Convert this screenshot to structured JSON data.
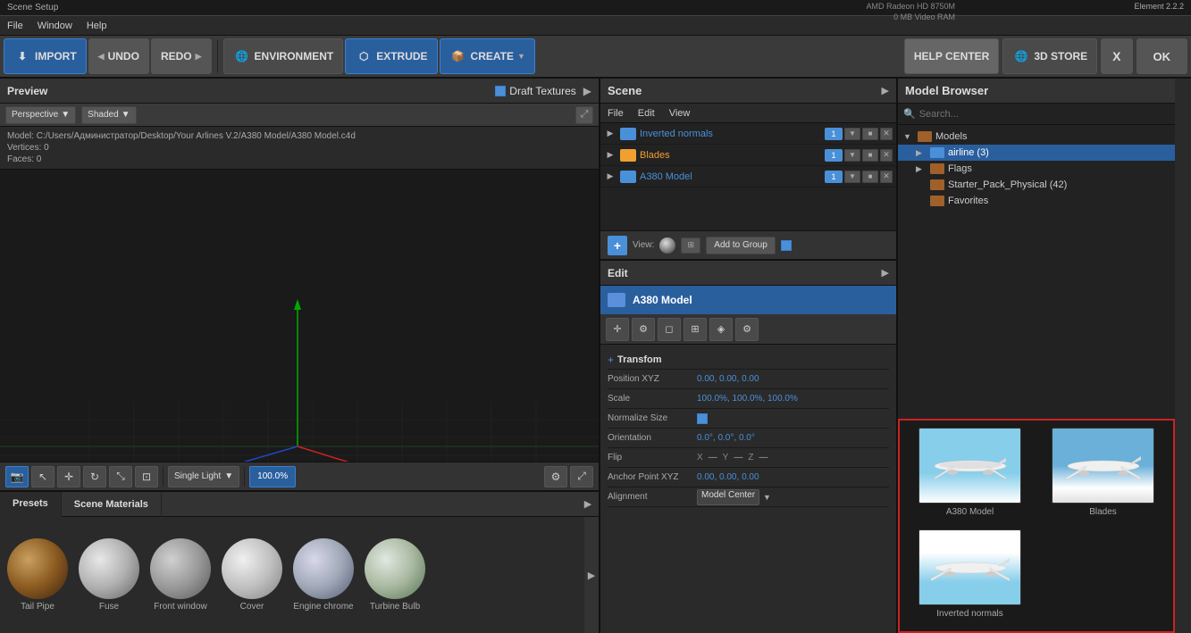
{
  "titlebar": {
    "text": "Scene Setup"
  },
  "menubar": {
    "items": [
      "File",
      "Window",
      "Help"
    ],
    "gpu": "AMD Radeon HD 8750M",
    "vram": "0 MB Video RAM",
    "version": "Element  2.2.2"
  },
  "toolbar": {
    "import_label": "IMPORT",
    "undo_label": "UNDO",
    "redo_label": "REDO",
    "environment_label": "ENVIRONMENT",
    "extrude_label": "EXTRUDE",
    "create_label": "CREATE",
    "help_label": "HELP CENTER",
    "store_label": "3D STORE",
    "x_label": "X",
    "ok_label": "OK"
  },
  "preview": {
    "title": "Preview",
    "draft_textures": "Draft Textures",
    "perspective_label": "Perspective",
    "shaded_label": "Shaded",
    "model_path": "Model: C:/Users/Администратор/Desktop/Your Arlines V.2/A380 Model/A380 Model.c4d",
    "vertices": "Vertices: 0",
    "faces": "Faces: 0",
    "single_light": "Single Light",
    "zoom": "100.0%"
  },
  "presets": {
    "tab_presets": "Presets",
    "tab_scene_materials": "Scene Materials",
    "materials": [
      {
        "name": "Tail Pipe",
        "type": "tail"
      },
      {
        "name": "Fuse",
        "type": "fuse"
      },
      {
        "name": "Front window",
        "type": "frontwindow"
      },
      {
        "name": "Cover",
        "type": "cover"
      },
      {
        "name": "Engine chrome",
        "type": "engine"
      },
      {
        "name": "Turbine Bulb",
        "type": "turbine"
      }
    ]
  },
  "scene": {
    "title": "Scene",
    "menu_file": "File",
    "menu_edit": "Edit",
    "menu_view": "View",
    "items": [
      {
        "name": "Inverted normals",
        "badge": "1",
        "color": "blue"
      },
      {
        "name": "Blades",
        "badge": "1",
        "color": "orange"
      },
      {
        "name": "A380 Model",
        "badge": "1",
        "color": "blue"
      }
    ],
    "view_label": "View:",
    "add_to_group": "Add to Group"
  },
  "edit": {
    "title": "Edit",
    "object_name": "A380 Model",
    "transform_label": "Transfom",
    "position_xyz_label": "Position XYZ",
    "position_x": "0.00",
    "position_y": "0.00",
    "position_z": "0.00",
    "scale_label": "Scale",
    "scale_x": "100.0%",
    "scale_y": "100.0%",
    "scale_z": "100.0%",
    "normalize_label": "Normalize Size",
    "orientation_label": "Orientation",
    "orient_x": "0.0°",
    "orient_y": "0.0°",
    "orient_z": "0.0°",
    "flip_label": "Flip",
    "flip_x": "X",
    "flip_y": "Y",
    "flip_z": "Z",
    "anchor_label": "Anchor Point XYZ",
    "anchor_x": "0.00",
    "anchor_y": "0.00",
    "anchor_z": "0.00",
    "alignment_label": "Alignment",
    "model_center": "Model Center"
  },
  "model_browser": {
    "title": "Model Browser",
    "search_placeholder": "Search...",
    "tree": [
      {
        "label": "Models",
        "type": "root",
        "indent": 0,
        "expanded": true
      },
      {
        "label": "airline (3)",
        "type": "folder",
        "indent": 1,
        "selected": true
      },
      {
        "label": "Flags",
        "type": "folder",
        "indent": 1
      },
      {
        "label": "Starter_Pack_Physical (42)",
        "type": "folder",
        "indent": 1
      },
      {
        "label": "Favorites",
        "type": "folder",
        "indent": 1
      }
    ],
    "thumbnails": [
      {
        "label": "A380 Model",
        "type": "plane1"
      },
      {
        "label": "Blades",
        "type": "plane2"
      },
      {
        "label": "Inverted normals",
        "type": "plane3"
      }
    ]
  }
}
